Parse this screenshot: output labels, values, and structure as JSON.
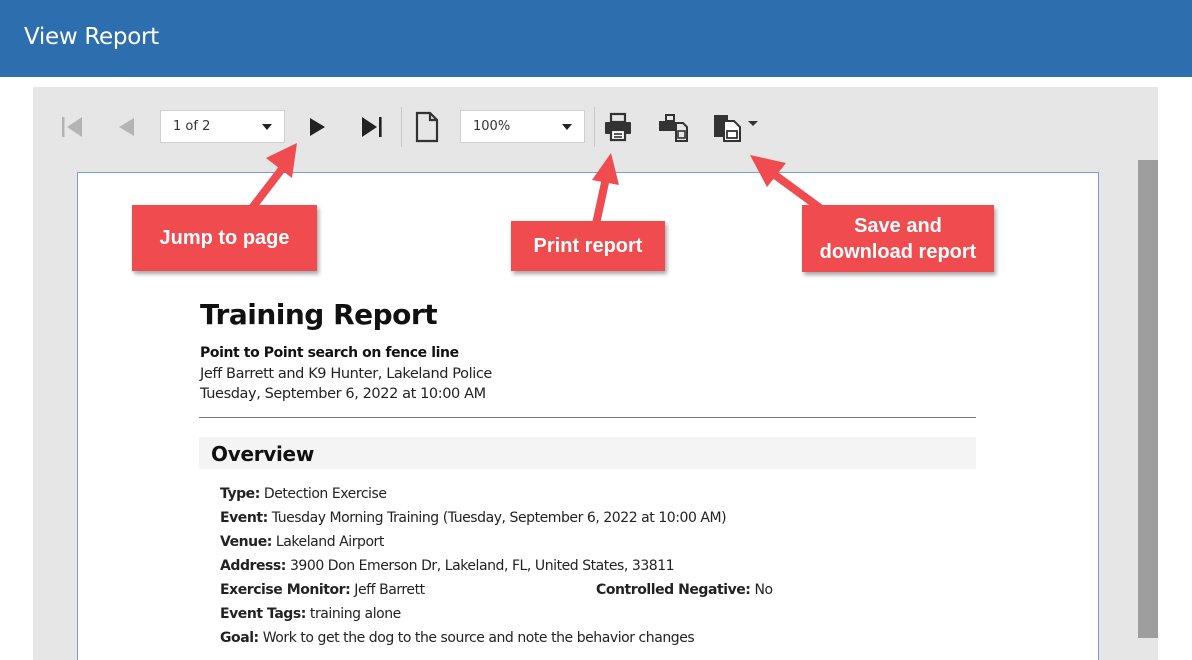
{
  "window": {
    "title": "View Report"
  },
  "toolbar": {
    "page_selector": {
      "value": "1 of 2"
    },
    "zoom_selector": {
      "value": "100%"
    },
    "icons": [
      "first-page-icon",
      "previous-page-icon",
      "next-page-icon",
      "last-page-icon",
      "page-layout-icon",
      "print-icon",
      "print-layout-icon",
      "export-icon"
    ]
  },
  "callouts": {
    "jump": "Jump to page",
    "print": "Print report",
    "save": "Save and download report"
  },
  "report": {
    "title": "Training Report",
    "subtitle": "Point to Point search on fence line",
    "handler_line": "Jeff Barrett and K9 Hunter, Lakeland Police",
    "date_line": "Tuesday, September 6, 2022 at 10:00 AM",
    "section_title": "Overview",
    "fields": {
      "type": {
        "label": "Type:",
        "value": "Detection Exercise"
      },
      "event": {
        "label": "Event:",
        "value": "Tuesday Morning Training  (Tuesday, September 6, 2022 at 10:00 AM)"
      },
      "venue": {
        "label": "Venue:",
        "value": "Lakeland Airport"
      },
      "address": {
        "label": "Address:",
        "value": "3900 Don Emerson Dr, Lakeland, FL, United States, 33811"
      },
      "monitor": {
        "label": "Exercise Monitor:",
        "value": "Jeff Barrett"
      },
      "negative": {
        "label": "Controlled Negative:",
        "value": "No"
      },
      "tags": {
        "label": "Event Tags:",
        "value": "training alone"
      },
      "goal": {
        "label": "Goal:",
        "value": "Work to get the dog to the source and note the behavior changes"
      }
    }
  },
  "colors": {
    "titlebar": "#2d6fae",
    "callout": "#f04b4e",
    "viewer_bg": "#e6e6e6"
  }
}
